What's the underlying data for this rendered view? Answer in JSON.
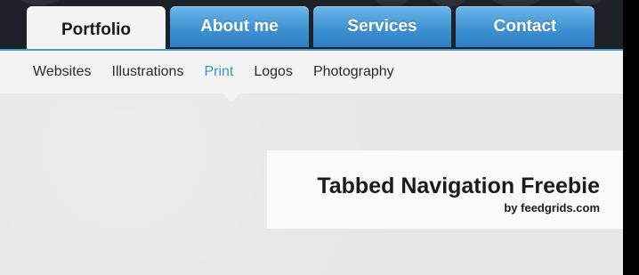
{
  "tabs": [
    {
      "label": "Portfolio",
      "active": true
    },
    {
      "label": "About me",
      "active": false
    },
    {
      "label": "Services",
      "active": false
    },
    {
      "label": "Contact",
      "active": false
    }
  ],
  "subnav": {
    "items": [
      "Websites",
      "Illustrations",
      "Print",
      "Logos",
      "Photography"
    ],
    "current": "Print"
  },
  "banner": {
    "title": "Tabbed Navigation Freebie",
    "subtitle": "by feedgrids.com"
  },
  "colors": {
    "accent": "#3f93d4",
    "tab_blue": "#3b8fd1",
    "background_dark": "#1e2127",
    "content_bg": "#e6e6e6"
  }
}
